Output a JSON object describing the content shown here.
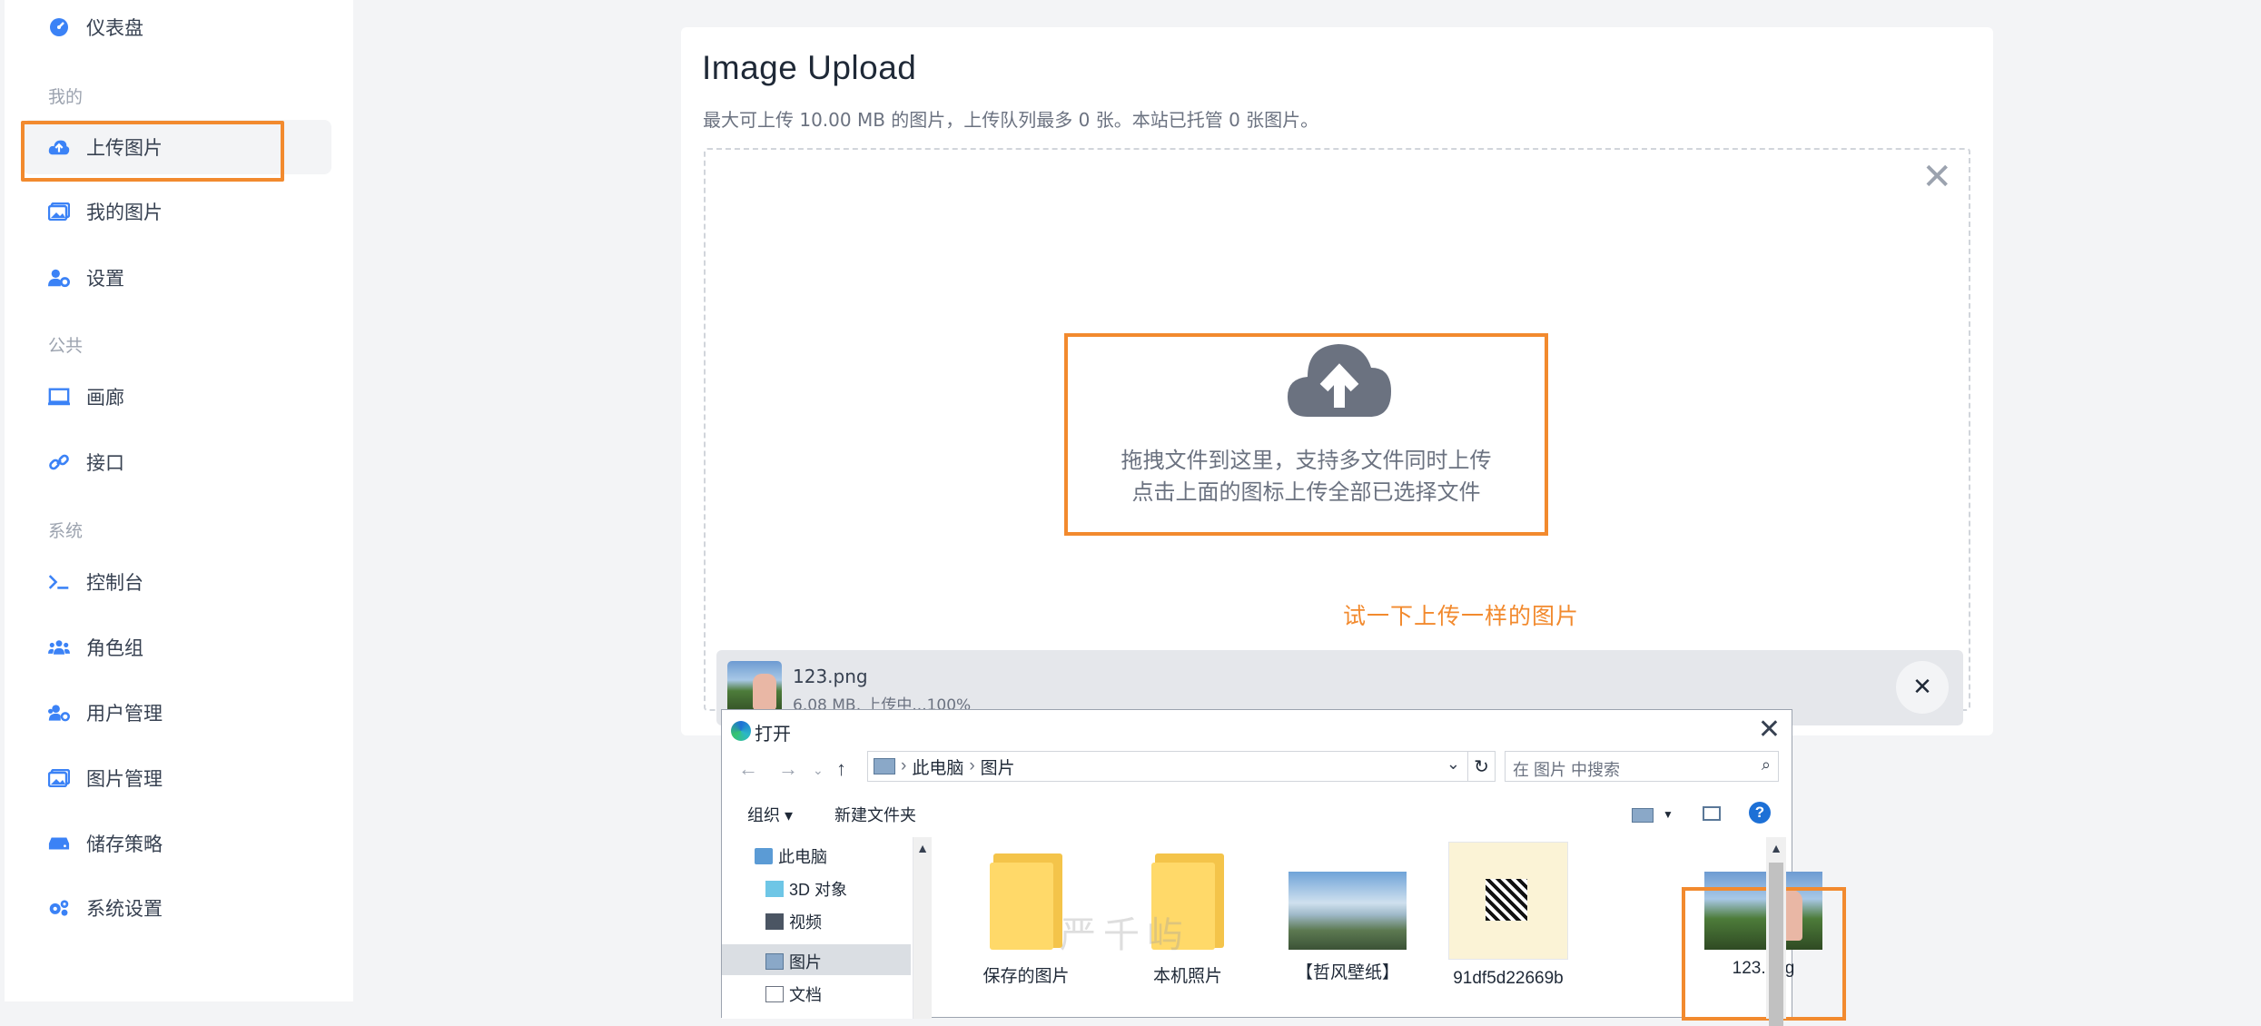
{
  "sidebar": {
    "items_top": [
      {
        "label": "仪表盘",
        "icon": "dashboard-icon"
      }
    ],
    "groups": [
      {
        "title": "我的",
        "items": [
          {
            "label": "上传图片",
            "icon": "cloud-upload-icon",
            "active": true
          },
          {
            "label": "我的图片",
            "icon": "images-icon"
          },
          {
            "label": "设置",
            "icon": "user-settings-icon"
          }
        ]
      },
      {
        "title": "公共",
        "items": [
          {
            "label": "画廊",
            "icon": "gallery-icon"
          },
          {
            "label": "接口",
            "icon": "link-icon"
          }
        ]
      },
      {
        "title": "系统",
        "items": [
          {
            "label": "控制台",
            "icon": "terminal-icon"
          },
          {
            "label": "角色组",
            "icon": "users-icon"
          },
          {
            "label": "用户管理",
            "icon": "user-manage-icon"
          },
          {
            "label": "图片管理",
            "icon": "images-manage-icon"
          },
          {
            "label": "储存策略",
            "icon": "storage-icon"
          },
          {
            "label": "系统设置",
            "icon": "system-settings-icon"
          }
        ]
      }
    ]
  },
  "upload": {
    "title": "Image Upload",
    "subtitle": "最大可上传 10.00 MB 的图片，上传队列最多 0 张。本站已托管 0 张图片。",
    "drop_line1": "拖拽文件到这里，支持多文件同时上传",
    "drop_line2": "点击上面的图标上传全部已选择文件",
    "annotation": "试一下上传一样的图片",
    "file": {
      "name": "123.png",
      "meta": "6.08 MB, 上传中...100%",
      "progress": 1.0
    }
  },
  "dialog": {
    "title": "打开",
    "path": [
      "此电脑",
      "图片"
    ],
    "search_placeholder": "在 图片 中搜索",
    "toolbar": {
      "organize": "组织 ▾",
      "new_folder": "新建文件夹"
    },
    "tree": [
      {
        "label": "此电脑",
        "icon": "computer-icon"
      },
      {
        "label": "3D 对象",
        "icon": "cube-icon"
      },
      {
        "label": "视频",
        "icon": "video-icon"
      },
      {
        "label": "图片",
        "icon": "pictures-icon",
        "selected": true
      },
      {
        "label": "文档",
        "icon": "document-icon"
      }
    ],
    "files": [
      {
        "label": "保存的图片",
        "kind": "folder"
      },
      {
        "label": "本机照片",
        "kind": "folder"
      },
      {
        "label": "【哲风壁纸】",
        "kind": "image"
      },
      {
        "label": "91df5d22669b",
        "kind": "image"
      },
      {
        "label": "123.png",
        "kind": "image",
        "highlighted": true
      }
    ],
    "watermark": "严千屿"
  },
  "colors": {
    "accent": "#3b82f6",
    "highlight": "#f28a2e"
  }
}
